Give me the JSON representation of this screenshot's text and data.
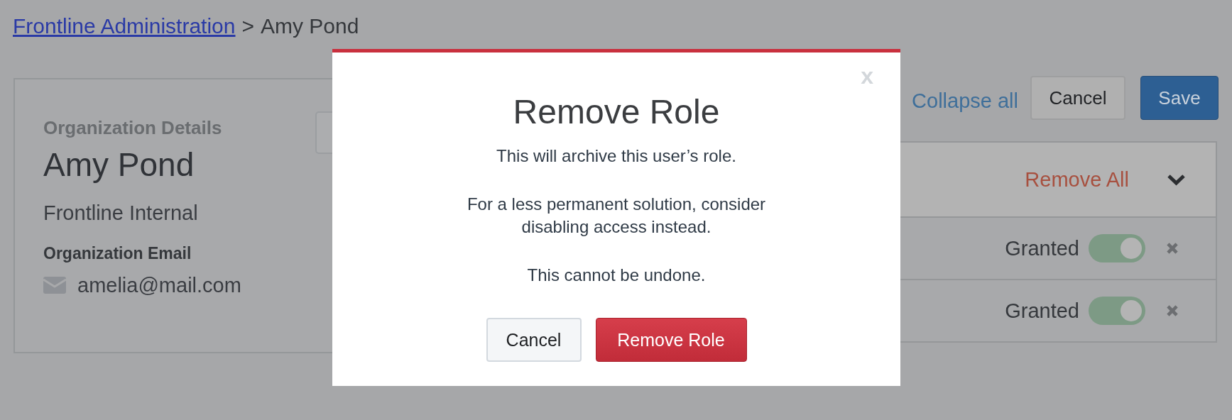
{
  "breadcrumb": {
    "link": "Frontline Administration",
    "separator": ">",
    "current": "Amy Pond"
  },
  "organization_card": {
    "heading": "Organization Details",
    "name": "Amy Pond",
    "organization": "Frontline Internal",
    "email_label": "Organization Email",
    "email": "amelia@mail.com"
  },
  "toolbar": {
    "collapse_link": "Collapse all",
    "cancel": "Cancel",
    "save": "Save"
  },
  "roles_panel": {
    "remove_all": "Remove All",
    "expanded": true,
    "rows": [
      {
        "status": "Granted",
        "on": true
      },
      {
        "status": "Granted",
        "on": true
      }
    ]
  },
  "dialog": {
    "close": "x",
    "title": "Remove Role",
    "paragraphs": [
      "This will archive this user’s role.",
      "For a less permanent solution, consider disabling access instead.",
      "This cannot be undone."
    ],
    "buttons": [
      {
        "label": "Cancel",
        "kind": "secondary"
      },
      {
        "label": "Remove Role",
        "kind": "danger"
      }
    ]
  }
}
